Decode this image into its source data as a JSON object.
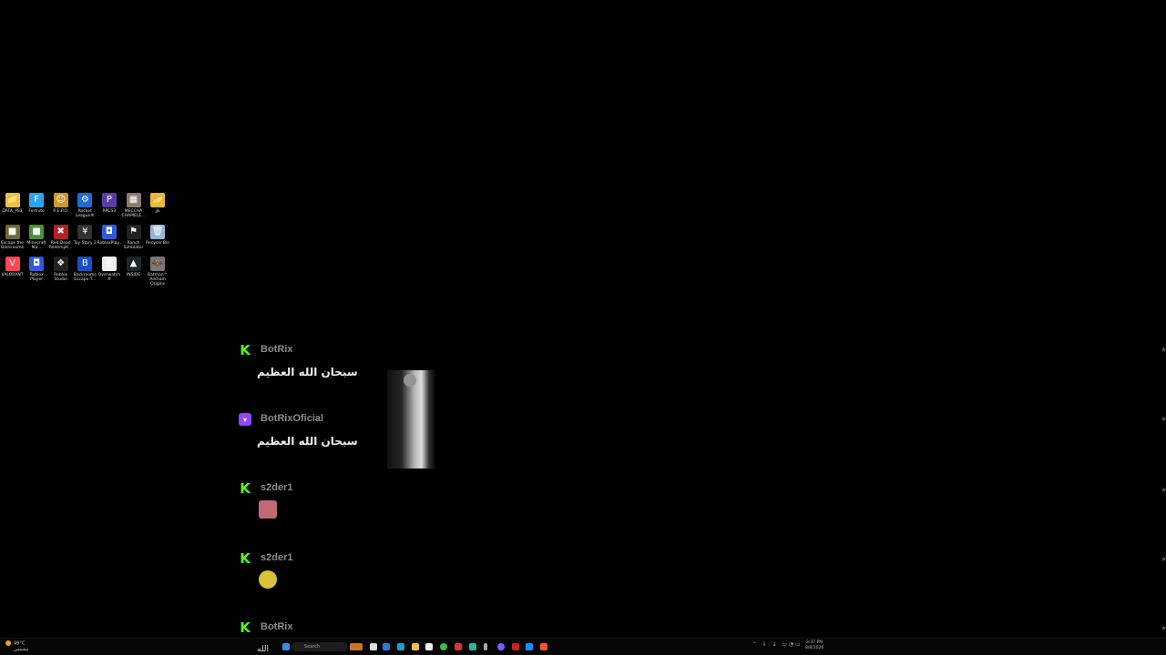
{
  "desktop": {
    "icons": [
      {
        "label": "DATA_PS3",
        "color": "#e8c24a",
        "glyph": "📁"
      },
      {
        "label": "Fortnite",
        "color": "#2ea3f2",
        "glyph": "F"
      },
      {
        "label": "R.E.P.O.",
        "color": "#c99a2e",
        "glyph": "☺"
      },
      {
        "label": "Rocket League®",
        "color": "#1e6bd6",
        "glyph": "⚙"
      },
      {
        "label": "RPCS3",
        "color": "#5a3ca8",
        "glyph": "P"
      },
      {
        "label": "MECCHA CHAMELE...",
        "color": "#8b7b70",
        "glyph": "▦"
      },
      {
        "label": "jjk",
        "color": "#e8b93c",
        "glyph": "📂"
      },
      {
        "label": "Escape the Backrooms",
        "color": "#6b6a3a",
        "glyph": "■"
      },
      {
        "label": "Minecraft Ma...",
        "color": "#4c8f3a",
        "glyph": "■"
      },
      {
        "label": "Red Dead Redempti...",
        "color": "#b22222",
        "glyph": "✖"
      },
      {
        "label": "Toy Story 3",
        "color": "#333",
        "glyph": "¥"
      },
      {
        "label": "RobloxPlay...",
        "color": "#2e5bdb",
        "glyph": "◘"
      },
      {
        "label": "Ranch Simulator",
        "color": "#222",
        "glyph": "⚑"
      },
      {
        "label": "Recycle Bin",
        "color": "#9ab6d6",
        "glyph": "🗑"
      },
      {
        "label": "VALORANT",
        "color": "#ff4655",
        "glyph": "V"
      },
      {
        "label": "Roblox Player",
        "color": "#2e5bdb",
        "glyph": "◘"
      },
      {
        "label": "Roblox Studio",
        "color": "#222",
        "glyph": "❖"
      },
      {
        "label": "Backrooms Escape T...",
        "color": "#1d4fc4",
        "glyph": "B"
      },
      {
        "label": "Overwatch®",
        "color": "#eee",
        "glyph": "◎"
      },
      {
        "label": "INSIDE",
        "color": "#1a2a2a",
        "glyph": "▲"
      },
      {
        "label": "Batman™ Arkham Origins",
        "color": "#777",
        "glyph": "🦇"
      }
    ]
  },
  "chat": {
    "messages": [
      {
        "platform": "kick",
        "user": "BotRix",
        "text": "سبحان الله العظيم"
      },
      {
        "platform": "twitch",
        "user": "BotRixOficial",
        "text": "سبحان الله العظيم"
      },
      {
        "platform": "kick",
        "user": "s2der1",
        "emote_color": "#c06a78"
      },
      {
        "platform": "kick",
        "user": "s2der1",
        "emote_color": "#d8c23a"
      },
      {
        "platform": "kick",
        "user": "BotRix"
      }
    ]
  },
  "taskbar": {
    "weather_temp": "49°C",
    "weather_desc": "مشمس",
    "search_placeholder": "Search",
    "time": "3:37 PM",
    "date": "8/8/2026",
    "partial_text": "الله"
  },
  "colors": {
    "kick": "#53fc18",
    "twitch": "#9146ff"
  }
}
